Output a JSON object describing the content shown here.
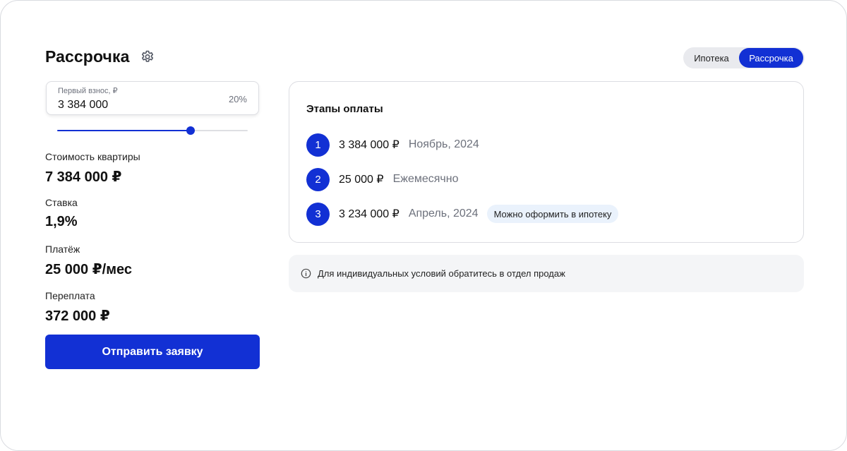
{
  "header": {
    "title": "Рассрочка",
    "settings_icon": "gear-icon"
  },
  "mode_switch": {
    "tabs": [
      {
        "label": "Ипотека",
        "active": false
      },
      {
        "label": "Рассрочка",
        "active": true
      }
    ]
  },
  "down_payment": {
    "label": "Первый взнос, ₽",
    "value": "3 384 000",
    "percent_text": "20%",
    "slider_fraction": 0.7
  },
  "stats": [
    {
      "label": "Стоимость квартиры",
      "value": "7 384 000 ₽"
    },
    {
      "label": "Ставка",
      "value": "1,9%"
    },
    {
      "label": "Платёж",
      "value": "25 000 ₽/мес"
    },
    {
      "label": "Переплата",
      "value": "372 000 ₽"
    }
  ],
  "submit_label": "Отправить заявку",
  "stages": {
    "title": "Этапы оплаты",
    "items": [
      {
        "number": "1",
        "amount": "3 384 000 ₽",
        "period": "Ноябрь, 2024",
        "badge": ""
      },
      {
        "number": "2",
        "amount": "25 000 ₽",
        "period": "Ежемесячно",
        "badge": ""
      },
      {
        "number": "3",
        "amount": "3 234 000 ₽",
        "period": "Апрель, 2024",
        "badge": "Можно оформить в ипотеку"
      }
    ]
  },
  "info": {
    "icon": "info-icon",
    "text": "Для индивидуальных условий обратитесь в отдел продаж"
  },
  "colors": {
    "accent": "#1230d4",
    "badge_bg": "#eaf2fc",
    "muted_text": "#6d717c"
  }
}
